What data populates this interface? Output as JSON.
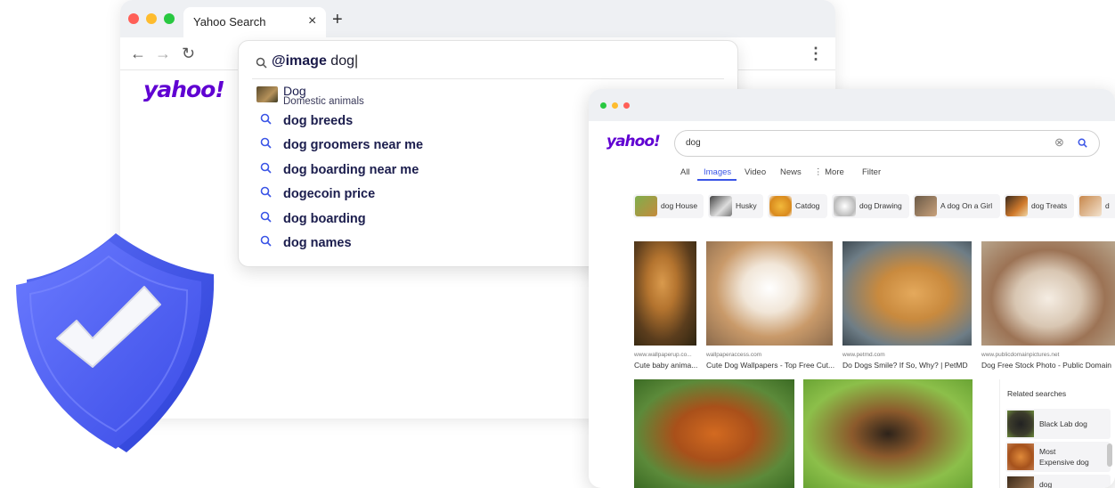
{
  "back_browser": {
    "tab_title": "Yahoo Search",
    "close_glyph": "×",
    "new_tab_glyph": "+",
    "back_glyph": "←",
    "forward_glyph": "→",
    "reload_glyph": "↻",
    "menu_glyph": "⋮",
    "logo": "yahoo!"
  },
  "search_dropdown": {
    "query_prefix": "@image",
    "query_term": " dog",
    "entity": {
      "title": "Dog",
      "subtitle": "Domestic animals"
    },
    "suggestions": [
      "dog breeds",
      "dog groomers near me",
      "dog boarding near me",
      "dogecoin price",
      "dog boarding",
      "dog names"
    ]
  },
  "results_browser": {
    "logo": "yahoo!",
    "search_value": "dog",
    "clear_glyph": "⊗",
    "tabs": [
      "All",
      "Images",
      "Video",
      "News",
      "⋮ More",
      "Filter"
    ],
    "active_tab": "Images",
    "chips": [
      "dog House",
      "Husky",
      "Catdog",
      "dog Drawing",
      "A dog On a Girl",
      "dog Treats",
      "d"
    ],
    "images_row1": [
      {
        "source": "www.wallpaperup.co...",
        "caption": "Cute baby anima..."
      },
      {
        "source": "wallpaperaccess.com",
        "caption": "Cute Dog Wallpapers - Top Free Cut..."
      },
      {
        "source": "www.petmd.com",
        "caption": "Do Dogs Smile? If So, Why? | PetMD"
      },
      {
        "source": "www.publicdomainpictures.net",
        "caption": "Dog Free Stock Photo - Public Domain"
      }
    ],
    "related": {
      "heading": "Related searches",
      "items": [
        "Black Lab dog",
        "Most\nExpensive dog",
        "dog"
      ]
    }
  },
  "colors": {
    "brand": "#6001d2",
    "accent": "#3b55e6",
    "link": "#1b1d4d"
  }
}
